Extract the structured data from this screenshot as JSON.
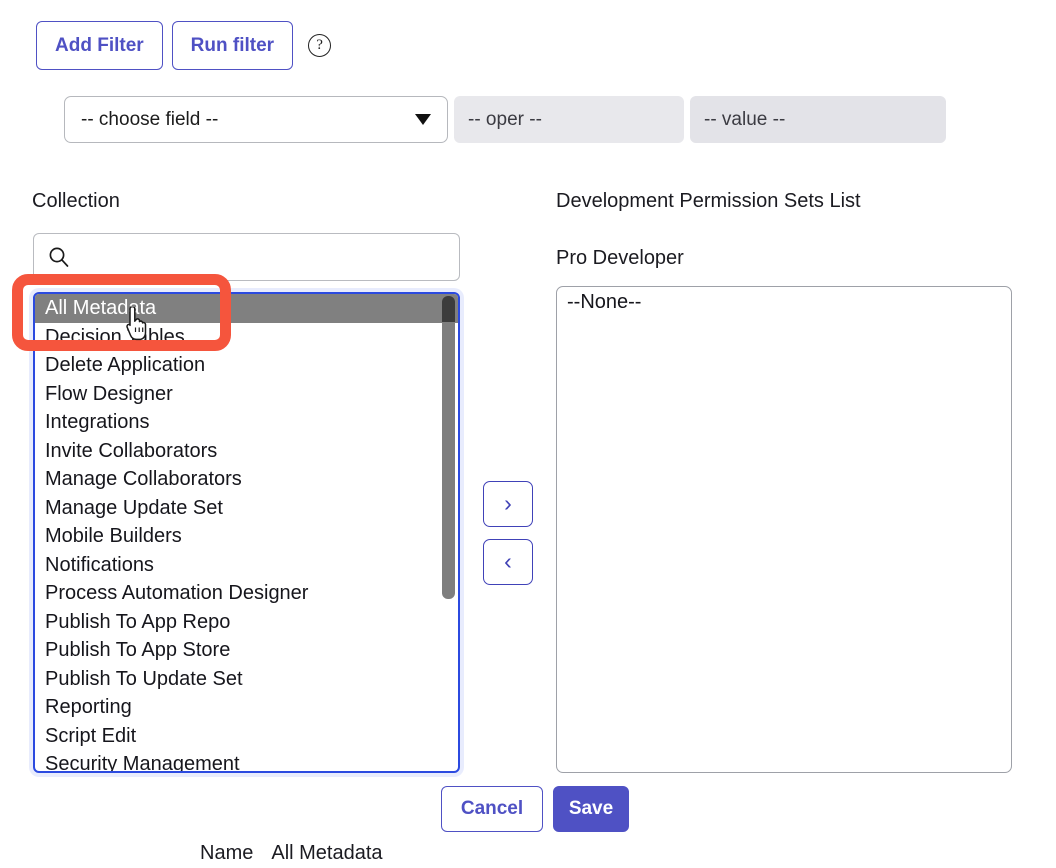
{
  "toolbar": {
    "add_filter_label": "Add Filter",
    "run_filter_label": "Run filter",
    "help_icon": "question-mark-circle-icon",
    "help_glyph": "?"
  },
  "filter_row": {
    "field_value": "-- choose field --",
    "field_caret_icon": "chevron-down-icon",
    "oper_value": "-- oper --",
    "value_value": "-- value --"
  },
  "left_panel": {
    "label": "Collection",
    "search": {
      "icon": "search-icon",
      "value": "",
      "placeholder": ""
    },
    "selected_option": "All Metadata",
    "options": [
      "All Metadata",
      "Decision Tables",
      "Delete Application",
      "Flow Designer",
      "Integrations",
      "Invite Collaborators",
      "Manage Collaborators",
      "Manage Update Set",
      "Mobile Builders",
      "Notifications",
      "Process Automation Designer",
      "Publish To App Repo",
      "Publish To App Store",
      "Publish To Update Set",
      "Reporting",
      "Script Edit",
      "Security Management"
    ]
  },
  "transfer": {
    "add_icon": "chevron-right-icon",
    "add_glyph": "›",
    "remove_icon": "chevron-left-icon",
    "remove_glyph": "‹"
  },
  "right_panel": {
    "title": "Development Permission Sets List",
    "subtitle": "Pro Developer",
    "options": [
      "--None--"
    ]
  },
  "footer": {
    "cancel_label": "Cancel",
    "save_label": "Save"
  },
  "name_row": {
    "label": "Name",
    "value": "All Metadata"
  },
  "annotation": {
    "color": "#f5553d",
    "target": "All Metadata"
  },
  "colors": {
    "accent": "#4f51c4",
    "list_border": "#2b4ae0",
    "selected_bg": "#808080",
    "annotation": "#f5553d",
    "flat_field_bg": "#e8e8ec"
  }
}
